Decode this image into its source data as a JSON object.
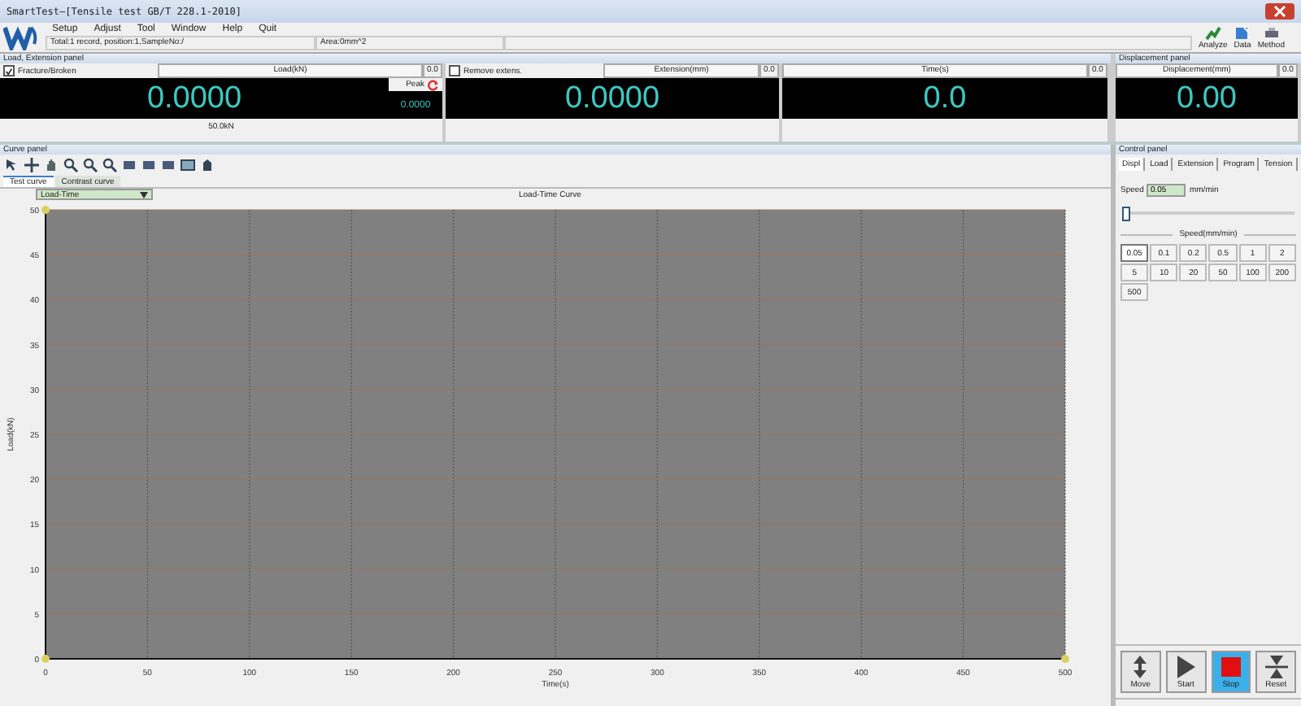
{
  "window": {
    "title": "SmartTest—[Tensile test GB/T 228.1-2010]"
  },
  "menu": [
    "Setup",
    "Adjust",
    "Tool",
    "Window",
    "Help",
    "Quit"
  ],
  "status": [
    "Total:1 record, position:1,SampleNo:/",
    "Area:0mm^2"
  ],
  "toolbar": [
    {
      "label": "Analyze",
      "kind": "analyze"
    },
    {
      "label": "Data",
      "kind": "data"
    },
    {
      "label": "Method",
      "kind": "method"
    }
  ],
  "load_panel": {
    "title": "Load, Extension panel",
    "meters": [
      {
        "kind": "load",
        "checkbox_label": "Fracture/Broken",
        "checked": true,
        "header": "Load(kN)",
        "corner": "0.0",
        "value": "0.0000",
        "peak_label": "Peak",
        "peak_value": "0.0000",
        "footer": "50.0kN"
      },
      {
        "kind": "extension",
        "checkbox_label": "Remove extens.",
        "checked": false,
        "header": "Extension(mm)",
        "corner": "0.0",
        "value": "0.0000"
      },
      {
        "kind": "time",
        "header": "Time(s)",
        "corner": "0.0",
        "value": "0.0"
      }
    ]
  },
  "displacement_panel": {
    "title": "Displacement panel",
    "header": "Displacement(mm)",
    "corner": "0.0",
    "value": "0.00"
  },
  "curve_panel": {
    "title": "Curve panel",
    "tabs": [
      {
        "label": "Test curve",
        "selected": true
      },
      {
        "label": "Contrast curve",
        "selected": false
      }
    ],
    "curve_select": "Load-Time",
    "chart_data": {
      "type": "line",
      "grid": true,
      "title": "Load-Time Curve",
      "xlabel": "Time(s)",
      "ylabel": "Load(kN)",
      "xlim": [
        0,
        500
      ],
      "ylim": [
        0,
        50
      ],
      "xticks": [
        0,
        50,
        100,
        150,
        200,
        250,
        300,
        350,
        400,
        450,
        500
      ],
      "yticks": [
        0,
        5,
        10,
        15,
        20,
        25,
        30,
        35,
        40,
        45,
        50
      ]
    }
  },
  "control_panel": {
    "title": "Control panel",
    "tabs": [
      {
        "label": "Displ",
        "selected": true
      },
      {
        "label": "Load",
        "selected": false
      },
      {
        "label": "Extension",
        "selected": false
      },
      {
        "label": "Program",
        "selected": false
      },
      {
        "label": "Tension",
        "selected": false
      }
    ],
    "speed_label": "Speed",
    "speed_value": "0.05",
    "speed_unit": "mm/min",
    "slider": {
      "level": 0
    },
    "speed_heading": "Speed(mm/min)",
    "presets": [
      {
        "label": "0.05",
        "selected": true
      },
      {
        "label": "0.1",
        "selected": false
      },
      {
        "label": "0.2",
        "selected": false
      },
      {
        "label": "0.5",
        "selected": false
      },
      {
        "label": "1",
        "selected": false
      },
      {
        "label": "2",
        "selected": false
      },
      {
        "label": "5",
        "selected": false
      },
      {
        "label": "10",
        "selected": false
      },
      {
        "label": "20",
        "selected": false
      },
      {
        "label": "50",
        "selected": false
      },
      {
        "label": "100",
        "selected": false
      },
      {
        "label": "200",
        "selected": false
      },
      {
        "label": "500",
        "selected": false
      }
    ],
    "actions": [
      {
        "label": "Move",
        "kind": "move",
        "selected": false
      },
      {
        "label": "Start",
        "kind": "start",
        "selected": false
      },
      {
        "label": "Stop",
        "kind": "stop",
        "selected": true
      },
      {
        "label": "Reset",
        "kind": "reset",
        "selected": false
      }
    ]
  }
}
